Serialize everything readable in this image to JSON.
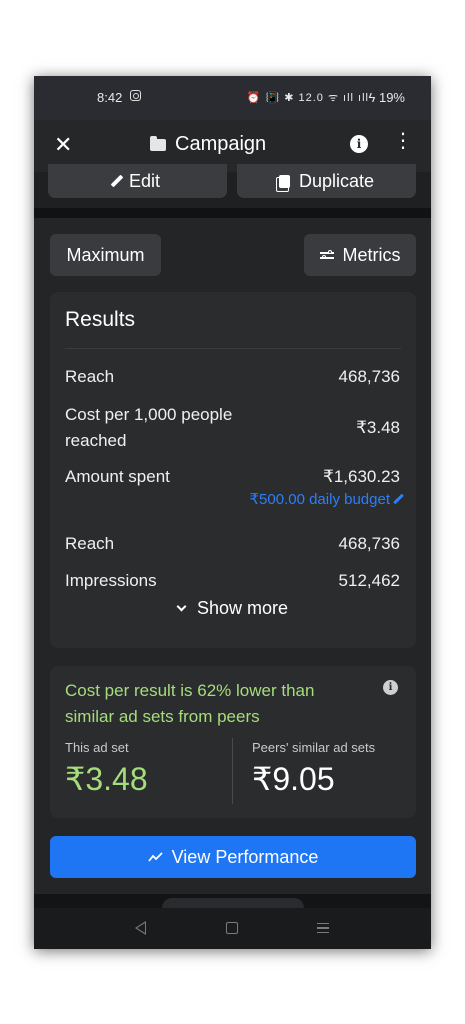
{
  "status_bar": {
    "time": "8:42",
    "indicators": "⏰ 📳 ✱ 12.0 ᯤ ıll ıll",
    "battery": "ϟ 19%"
  },
  "header": {
    "title": "Campaign"
  },
  "actions": {
    "edit_label": "Edit",
    "duplicate_label": "Duplicate"
  },
  "toolbar": {
    "maximum_label": "Maximum",
    "metrics_label": "Metrics"
  },
  "results": {
    "title": "Results",
    "rows": [
      {
        "label": "Reach",
        "value": "468,736"
      },
      {
        "label": "Cost per 1,000 people reached",
        "value": "₹3.48"
      },
      {
        "label": "Amount spent",
        "value": "₹1,630.23"
      },
      {
        "label": "Reach",
        "value": "468,736"
      },
      {
        "label": "Impressions",
        "value": "512,462"
      }
    ],
    "budget_link": "₹500.00 daily budget",
    "show_more": "Show more"
  },
  "peer_comparison": {
    "message": "Cost per result is 62% lower than similar ad sets from peers",
    "this_label": "This ad set",
    "this_value": "₹3.48",
    "peers_label": "Peers' similar ad sets",
    "peers_value": "₹9.05"
  },
  "cta": {
    "view_performance": "View Performance"
  },
  "colors": {
    "accent_blue": "#1f76f5",
    "positive_green": "#a5dd7c",
    "link_blue": "#2d7ef7"
  }
}
